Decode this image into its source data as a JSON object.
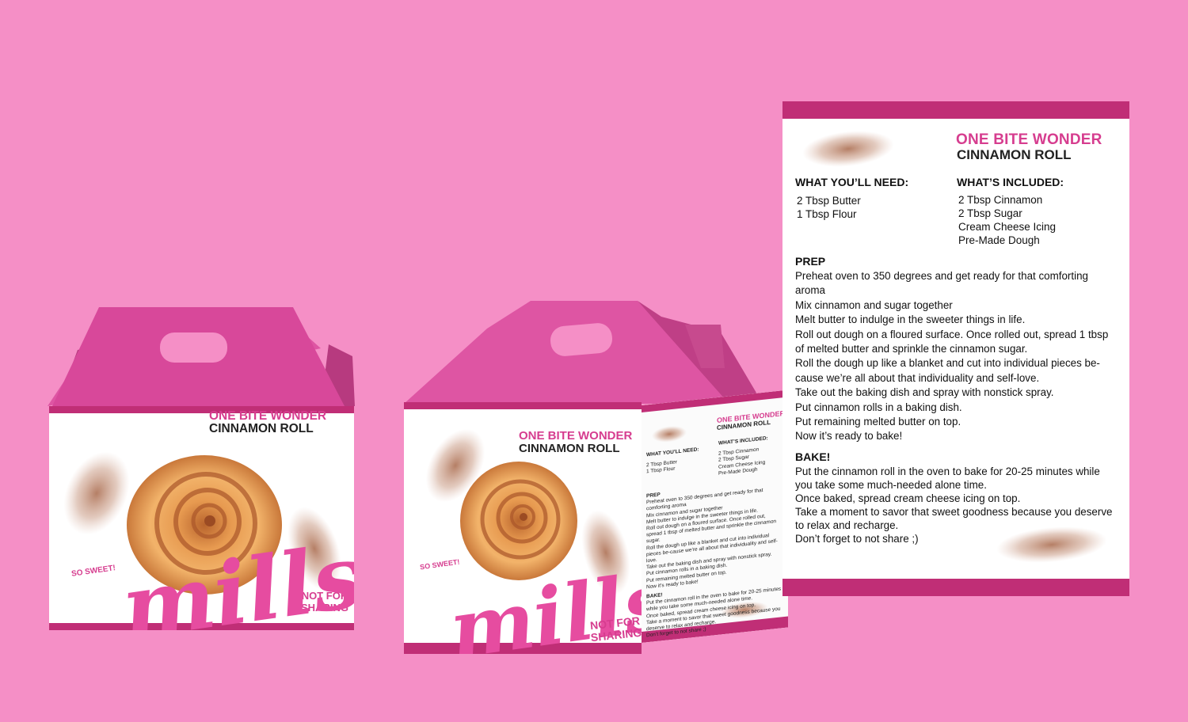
{
  "product": {
    "title_line1": "ONE BITE WONDER",
    "title_line2": "CINNAMON ROLL",
    "badge": "SO SWEET!",
    "tagline_line1": "NOT FOR",
    "tagline_line2": "SHARING",
    "brand": "mills"
  },
  "recipe": {
    "need_heading": "WHAT YOU’LL NEED:",
    "need_items": [
      "2 Tbsp Butter",
      "1 Tbsp Flour"
    ],
    "included_heading": "WHAT’S INCLUDED:",
    "included_items": [
      "2 Tbsp Cinnamon",
      "2 Tbsp Sugar",
      "Cream Cheese Icing",
      "Pre-Made Dough"
    ],
    "prep_heading": "PREP",
    "prep_steps": [
      "Preheat oven to 350 degrees and get ready for that comforting aroma",
      "Mix cinnamon and sugar together",
      "Melt butter to indulge in the sweeter things in life.",
      "Roll out dough on a floured surface. Once rolled out, spread 1 tbsp of melted butter and sprinkle the cinnamon sugar.",
      "Roll the dough up like a blanket and cut into individual pieces be-cause we’re all about that individuality and self-love.",
      "Take out the baking dish and spray with nonstick spray.",
      "Put cinnamon rolls in a baking dish.",
      "Put remaining melted butter on top.",
      "Now it’s ready to bake!"
    ],
    "bake_heading": "BAKE!",
    "bake_steps": [
      "Put the cinnamon roll in the oven to bake for 20-25 minutes while you take some much-needed alone time.",
      "Once baked, spread cream cheese icing on top.",
      "Take a moment to savor that sweet goodness because you deserve to relax and recharge.",
      "Don’t forget to not share ;)"
    ]
  },
  "colors": {
    "background": "#f58fc6",
    "accent": "#c02e76",
    "title_pink": "#d63d8f",
    "box_top": "#d8489a"
  }
}
